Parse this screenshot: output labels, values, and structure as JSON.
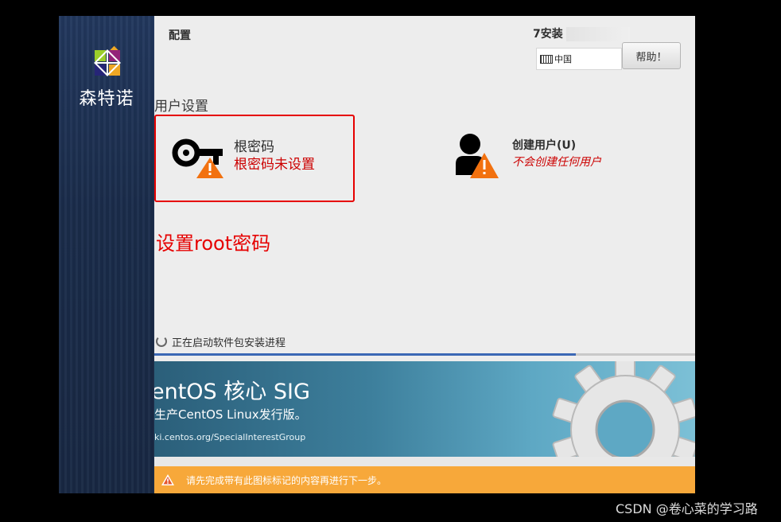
{
  "brand": {
    "name": "森特诺"
  },
  "header": {
    "page_title": "配置",
    "install_title": "7安装",
    "keyboard_layout": "中国",
    "help_label": "帮助！"
  },
  "user_settings": {
    "section_title": "用户设置",
    "root_password": {
      "title": "根密码",
      "status": "根密码未设置"
    },
    "create_user": {
      "title": "创建用户(U)",
      "status": "不会创建任何用户"
    }
  },
  "annotation": "设置root密码",
  "progress": {
    "text": "正在启动软件包安装进程",
    "fraction": 0.78
  },
  "banner": {
    "title": "entOS 核心 SIG",
    "description": "生产CentOS Linux发行版。",
    "url": "ki.centos.org/SpecialInterestGroup"
  },
  "warning": {
    "text": "请先完成带有此图标标记的内容再进行下一步。"
  },
  "watermark": "CSDN @卷心菜的学习路",
  "colors": {
    "warning": "#f7a83a",
    "error_text": "#cc0000",
    "highlight": "#e60000",
    "progress": "#3b68b5"
  }
}
